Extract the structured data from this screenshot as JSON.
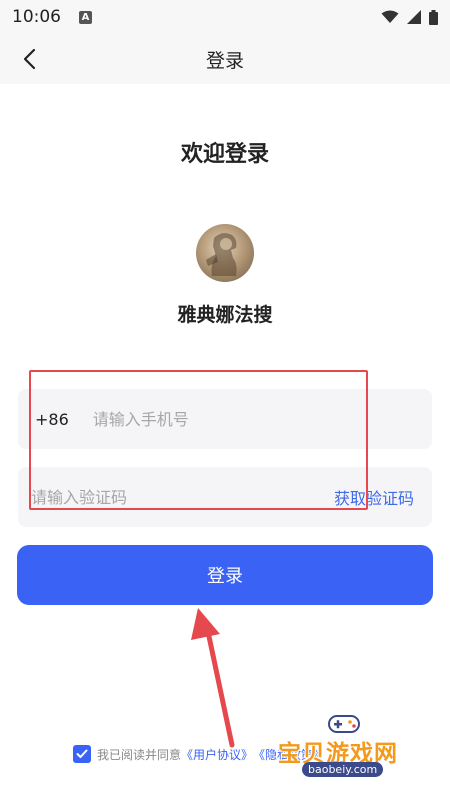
{
  "status_bar": {
    "time": "10:06",
    "notification_icon_letter": "A",
    "icons": [
      "wifi-icon",
      "signal-icon",
      "battery-icon"
    ]
  },
  "nav": {
    "back_icon": "chevron-left-icon",
    "title": "登录"
  },
  "welcome": "欢迎登录",
  "app": {
    "name": "雅典娜法搜",
    "logo_icon": "app-logo"
  },
  "phone_field": {
    "country_code": "+86",
    "placeholder": "请输入手机号",
    "value": ""
  },
  "code_field": {
    "placeholder": "请输入验证码",
    "value": "",
    "get_code_label": "获取验证码"
  },
  "login_button": {
    "label": "登录"
  },
  "agreement": {
    "checked": true,
    "text": "我已阅读并同意",
    "user_agreement": "《用户协议》",
    "privacy_policy": "《隐私政策》"
  },
  "watermark": {
    "text": "宝贝游戏网",
    "domain": "baobeiy.com"
  },
  "colors": {
    "accent": "#3a63f5",
    "link": "#3f6ae8",
    "annotation_red": "#e5484d",
    "watermark_orange": "#f39a1c"
  }
}
